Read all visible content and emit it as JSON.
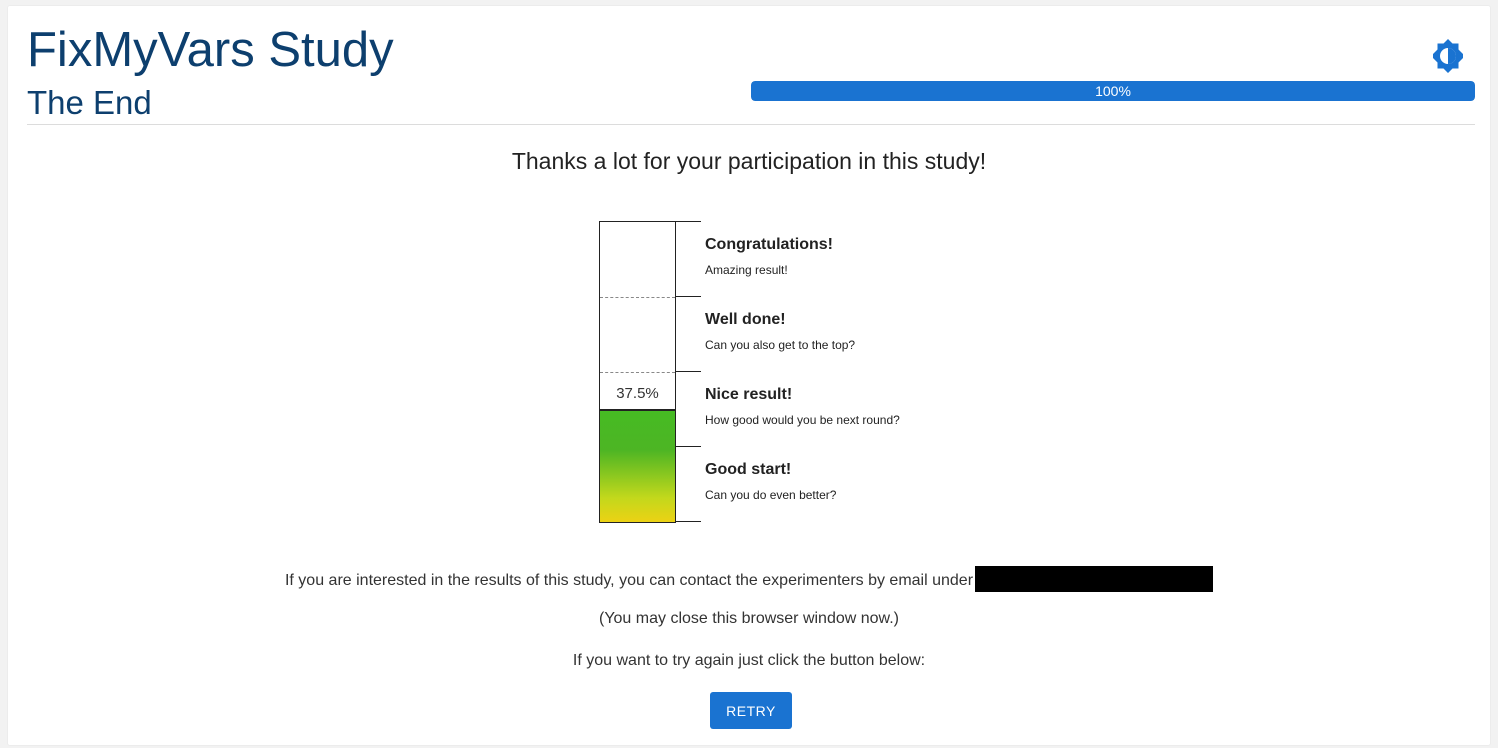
{
  "header": {
    "title": "FixMyVars Study",
    "subtitle": "The End",
    "theme_icon": "brightness-icon",
    "progress": {
      "value": 1.0,
      "label": "100%"
    }
  },
  "main": {
    "thanks": "Thanks a lot for your participation in this study!",
    "score": {
      "value": 0.375,
      "label": "37.5%"
    },
    "levels": [
      {
        "title": "Congratulations!",
        "desc": "Amazing result!"
      },
      {
        "title": "Well done!",
        "desc": "Can you also get to the top?"
      },
      {
        "title": "Nice result!",
        "desc": "How good would you be next round?"
      },
      {
        "title": "Good start!",
        "desc": "Can you do even better?"
      }
    ],
    "contact_text": "If you are interested in the results of this study, you can contact the experimenters by email under",
    "close_text": "(You may close this browser window now.)",
    "retry_prompt": "If you want to try again just click the button below:",
    "retry_label": "RETRY"
  },
  "colors": {
    "primary": "#1a73d1",
    "title": "#0d3f6e",
    "meter_top": "#46bb23",
    "meter_bottom": "#ecd214"
  }
}
